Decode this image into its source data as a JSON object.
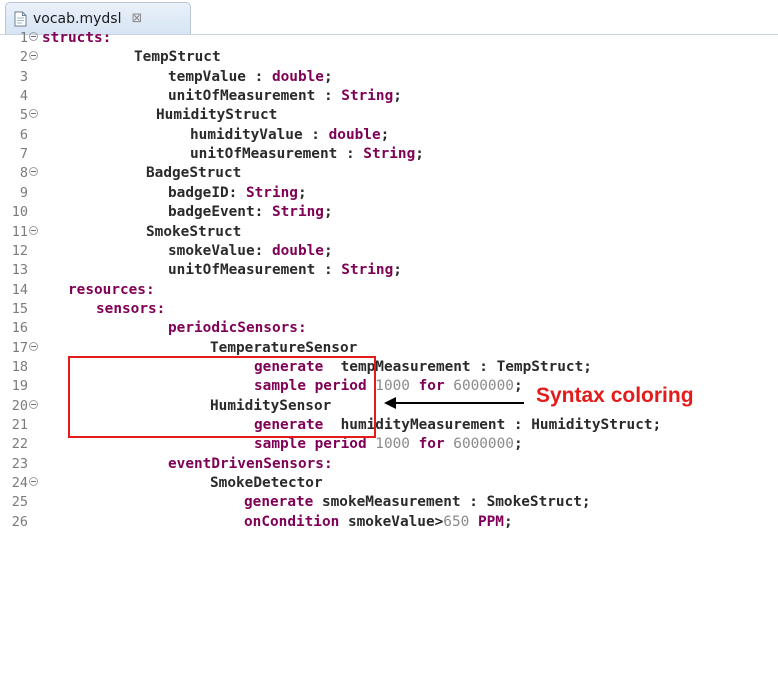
{
  "tab": {
    "title": "vocab.mydsl",
    "close_glyph": "⊠",
    "icon": "file-icon"
  },
  "annotation": {
    "label": "Syntax coloring",
    "color": "#e41b1b"
  },
  "colors": {
    "keyword": "#7f0055",
    "identifier": "#2a2a2a",
    "number": "#8a8a8a",
    "line_number": "#7b7b7b"
  },
  "lines": [
    {
      "n": "1",
      "fold": true,
      "segs": [
        [
          "kw",
          "structs:"
        ]
      ]
    },
    {
      "n": "2",
      "fold": true,
      "segs": [
        [
          "id",
          "TempStruct"
        ]
      ]
    },
    {
      "n": "3",
      "fold": false,
      "segs": [
        [
          "id",
          "tempValue : "
        ],
        [
          "kw",
          "double"
        ],
        [
          "id",
          ";"
        ]
      ]
    },
    {
      "n": "4",
      "fold": false,
      "segs": [
        [
          "id",
          "unitOfMeasurement : "
        ],
        [
          "kw",
          "String"
        ],
        [
          "id",
          ";"
        ]
      ]
    },
    {
      "n": "5",
      "fold": true,
      "segs": [
        [
          "id",
          "HumidityStruct"
        ]
      ]
    },
    {
      "n": "6",
      "fold": false,
      "segs": [
        [
          "id",
          "humidityValue : "
        ],
        [
          "kw",
          "double"
        ],
        [
          "id",
          ";"
        ]
      ]
    },
    {
      "n": "7",
      "fold": false,
      "segs": [
        [
          "id",
          "unitOfMeasurement : "
        ],
        [
          "kw",
          "String"
        ],
        [
          "id",
          ";"
        ]
      ]
    },
    {
      "n": "8",
      "fold": true,
      "segs": [
        [
          "id",
          "BadgeStruct"
        ]
      ]
    },
    {
      "n": "9",
      "fold": false,
      "segs": [
        [
          "id",
          "badgeID: "
        ],
        [
          "kw",
          "String"
        ],
        [
          "id",
          ";"
        ]
      ]
    },
    {
      "n": "10",
      "fold": false,
      "segs": [
        [
          "id",
          "badgeEvent: "
        ],
        [
          "kw",
          "String"
        ],
        [
          "id",
          ";"
        ]
      ]
    },
    {
      "n": "11",
      "fold": true,
      "segs": [
        [
          "id",
          "SmokeStruct"
        ]
      ]
    },
    {
      "n": "12",
      "fold": false,
      "segs": [
        [
          "id",
          "smokeValue: "
        ],
        [
          "kw",
          "double"
        ],
        [
          "id",
          ";"
        ]
      ]
    },
    {
      "n": "13",
      "fold": false,
      "segs": [
        [
          "id",
          "unitOfMeasurement : "
        ],
        [
          "kw",
          "String"
        ],
        [
          "id",
          ";"
        ]
      ]
    },
    {
      "n": "14",
      "fold": false,
      "segs": [
        [
          "kw",
          "resources:"
        ]
      ]
    },
    {
      "n": "15",
      "fold": false,
      "segs": [
        [
          "kw",
          "sensors:"
        ]
      ]
    },
    {
      "n": "16",
      "fold": false,
      "segs": [
        [
          "kw",
          "periodicSensors:"
        ]
      ]
    },
    {
      "n": "17",
      "fold": true,
      "segs": [
        [
          "id",
          "TemperatureSensor"
        ]
      ]
    },
    {
      "n": "18",
      "fold": false,
      "segs": [
        [
          "kw",
          "generate"
        ],
        [
          "id",
          "  tempMeasurement : TempStruct;"
        ]
      ]
    },
    {
      "n": "19",
      "fold": false,
      "segs": [
        [
          "kw",
          "sample period "
        ],
        [
          "num",
          "1000"
        ],
        [
          "kw",
          " for "
        ],
        [
          "num",
          "6000000"
        ],
        [
          "id",
          ";"
        ]
      ]
    },
    {
      "n": "20",
      "fold": true,
      "segs": [
        [
          "id",
          "HumiditySensor"
        ]
      ]
    },
    {
      "n": "21",
      "fold": false,
      "segs": [
        [
          "kw",
          "generate"
        ],
        [
          "id",
          "  humidityMeasurement : HumidityStruct;"
        ]
      ]
    },
    {
      "n": "22",
      "fold": false,
      "segs": [
        [
          "kw",
          "sample period "
        ],
        [
          "num",
          "1000"
        ],
        [
          "kw",
          " for "
        ],
        [
          "num",
          "6000000"
        ],
        [
          "id",
          ";"
        ]
      ]
    },
    {
      "n": "23",
      "fold": false,
      "segs": [
        [
          "kw",
          "eventDrivenSensors:"
        ]
      ]
    },
    {
      "n": "24",
      "fold": true,
      "segs": [
        [
          "id",
          "SmokeDetector"
        ]
      ]
    },
    {
      "n": "25",
      "fold": false,
      "segs": [
        [
          "kw",
          "generate"
        ],
        [
          "id",
          " smokeMeasurement : SmokeStruct;"
        ]
      ]
    },
    {
      "n": "26",
      "fold": false,
      "segs": [
        [
          "kw",
          "onCondition"
        ],
        [
          "id",
          " smokeValue>"
        ],
        [
          "num",
          "650"
        ],
        [
          "id",
          " "
        ],
        [
          "kw",
          "PPM"
        ],
        [
          "id",
          ";"
        ]
      ]
    }
  ]
}
